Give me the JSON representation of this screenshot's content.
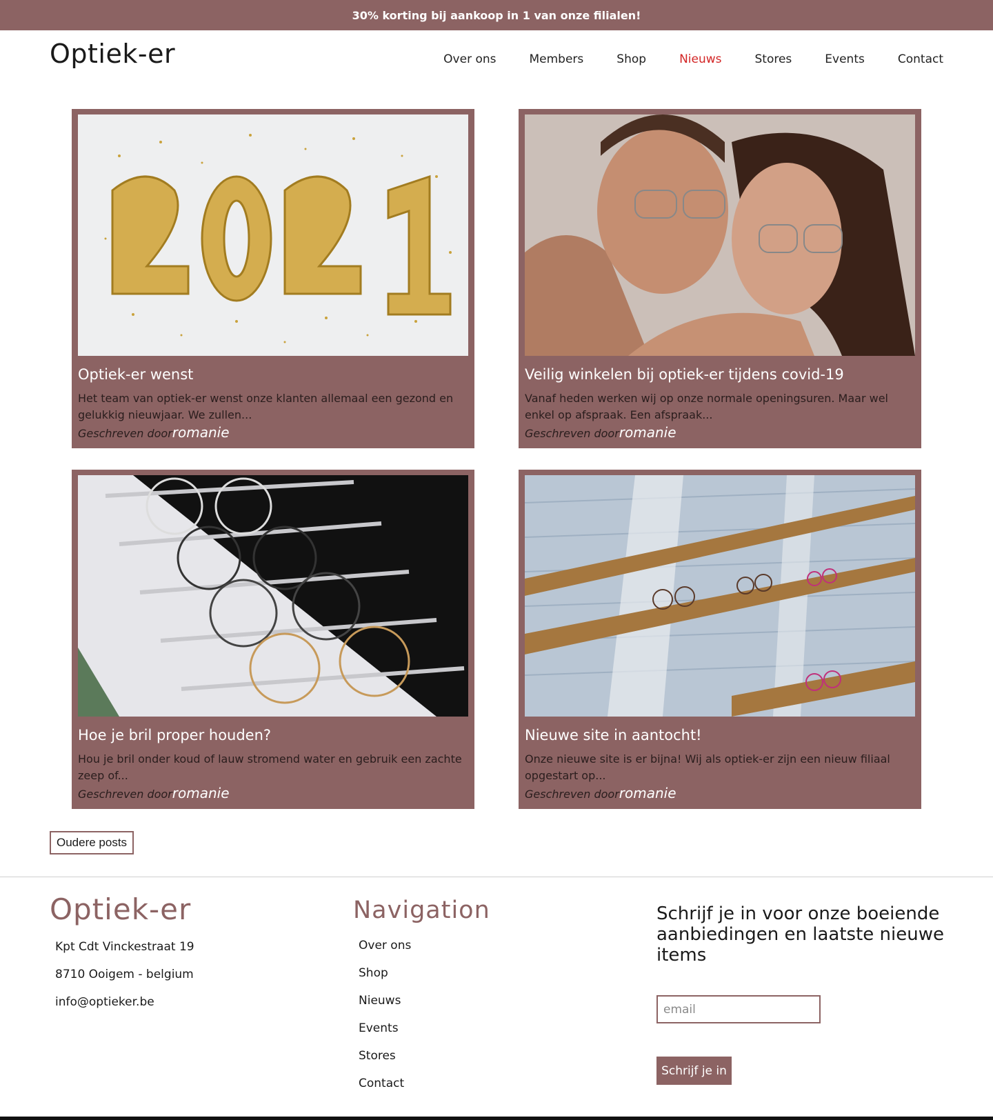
{
  "promo": "30% korting bij aankoop in 1 van onze filialen!",
  "logo": "Optiek-er",
  "nav": [
    "Over ons",
    "Members",
    "Shop",
    "Nieuws",
    "Stores",
    "Events",
    "Contact"
  ],
  "nav_active": "Nieuws",
  "posts": [
    {
      "title": "Optiek-er wenst",
      "excerpt": "Het team van optiek-er wenst onze klanten allemaal een gezond en gelukkig nieuwjaar. We zullen...",
      "by": "Geschreven door",
      "author": "romanie",
      "image": "2021-balloons-image"
    },
    {
      "title": "Veilig winkelen bij optiek-er tijdens covid-19",
      "excerpt": "Vanaf heden werken wij op onze normale openingsuren. Maar wel enkel op afspraak. Een afspraak...",
      "by": "Geschreven door",
      "author": "romanie",
      "image": "couple-glasses-image"
    },
    {
      "title": "Hoe je bril proper houden?",
      "excerpt": "Hou je bril onder koud of lauw stromend water en gebruik een zachte zeep of...",
      "by": "Geschreven door",
      "author": "romanie",
      "image": "glasses-drawer-image"
    },
    {
      "title": "Nieuwe site in aantocht!",
      "excerpt": "Onze nieuwe site is er bijna! Wij als optiek-er zijn een nieuw filiaal opgestart op...",
      "by": "Geschreven door",
      "author": "romanie",
      "image": "store-shelves-image"
    }
  ],
  "older_posts": "Oudere posts",
  "footer": {
    "logo": "Optiek-er",
    "address": [
      "Kpt Cdt Vinckestraat 19",
      "8710 Ooigem - belgium",
      "info@optieker.be"
    ],
    "nav_title": "Navigation",
    "nav": [
      "Over ons",
      "Shop",
      "Nieuws",
      "Events",
      "Stores",
      "Contact"
    ],
    "subscribe_title": "Schrijf je in voor onze boeiende aanbiedingen en laatste nieuwe items",
    "email_placeholder": "email",
    "subscribe_button": "Schrijf je in"
  },
  "colors": {
    "brand": "#8c6363",
    "active_nav": "#d32626"
  }
}
